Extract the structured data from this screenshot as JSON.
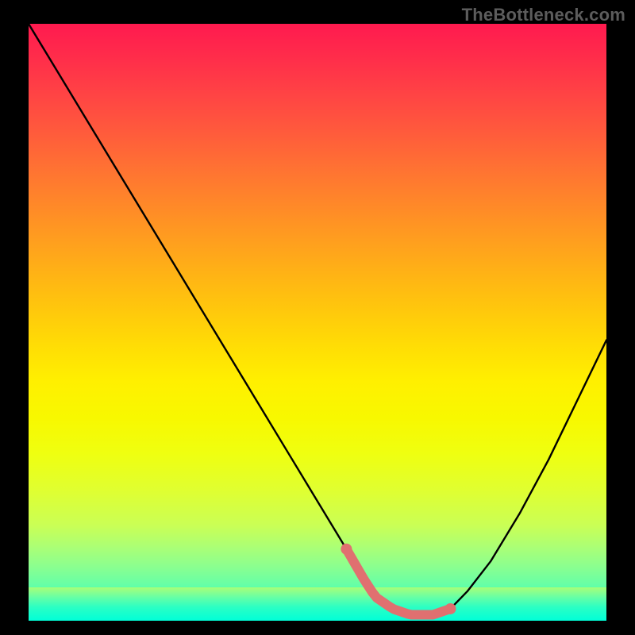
{
  "watermark": "TheBottleneck.com",
  "colors": {
    "background": "#000000",
    "curve": "#000000",
    "highlight": "#e07070",
    "gradient_top": "#ff1a4f",
    "gradient_mid": "#ffe000",
    "gradient_bottom": "#00ffd8"
  },
  "chart_data": {
    "type": "line",
    "title": "",
    "xlabel": "",
    "ylabel": "",
    "xlim": [
      0,
      100
    ],
    "ylim": [
      0,
      100
    ],
    "series": [
      {
        "name": "bottleneck-curve",
        "x": [
          0,
          5,
          10,
          15,
          20,
          25,
          30,
          35,
          40,
          45,
          50,
          55,
          58,
          60,
          63,
          66,
          68,
          70,
          73,
          76,
          80,
          85,
          90,
          95,
          100
        ],
        "y": [
          100,
          92,
          84,
          76,
          68,
          60,
          52,
          44,
          36,
          28,
          20,
          12,
          7,
          4,
          2,
          1,
          1,
          1,
          2,
          5,
          10,
          18,
          27,
          37,
          47
        ]
      }
    ],
    "annotations": [
      {
        "name": "optimal-range-highlight",
        "x_start": 55,
        "x_end": 73,
        "y": 2
      }
    ]
  }
}
